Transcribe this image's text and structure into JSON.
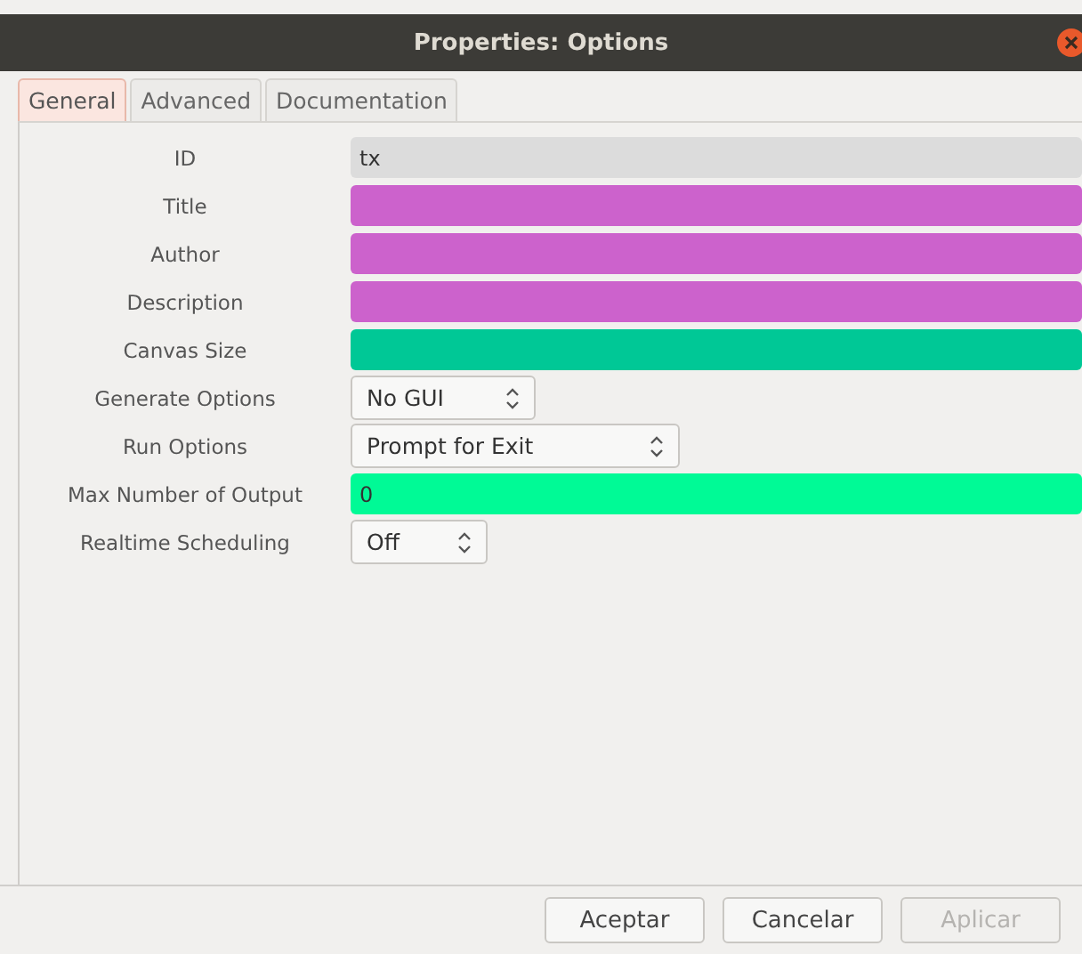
{
  "window": {
    "title": "Properties: Options"
  },
  "tabs": [
    {
      "label": "General",
      "selected": true
    },
    {
      "label": "Advanced",
      "selected": false
    },
    {
      "label": "Documentation",
      "selected": false
    }
  ],
  "fields": [
    {
      "label": "ID",
      "kind": "text",
      "value": "tx",
      "color": "#dcdcdc"
    },
    {
      "label": "Title",
      "kind": "text",
      "color": "#cc62cc"
    },
    {
      "label": "Author",
      "kind": "text",
      "color": "#cc62cc"
    },
    {
      "label": "Description",
      "kind": "text",
      "color": "#cc62cc"
    },
    {
      "label": "Canvas Size",
      "kind": "text",
      "color": "#00c896"
    },
    {
      "label": "Generate Options",
      "kind": "dropdown",
      "value": "No GUI"
    },
    {
      "label": "Run Options",
      "kind": "dropdown",
      "value": "Prompt for Exit"
    },
    {
      "label": "Max Number of Output",
      "kind": "text",
      "value": "0",
      "color": "#00fa96"
    },
    {
      "label": "Realtime Scheduling",
      "kind": "dropdown",
      "value": "Off"
    }
  ],
  "buttons": [
    {
      "label": "Aceptar",
      "disabled": false
    },
    {
      "label": "Cancelar",
      "disabled": false
    },
    {
      "label": "Aplicar",
      "disabled": true
    }
  ]
}
